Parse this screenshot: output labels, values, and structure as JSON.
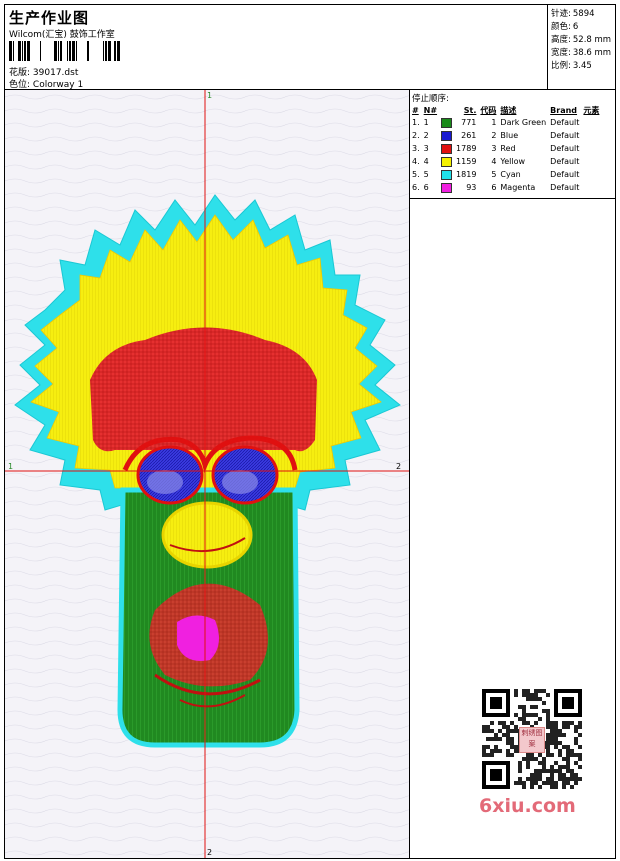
{
  "header": {
    "title": "生产作业图",
    "company": "Wilcom(汇宝) 鼓饰工作室",
    "design_label": "花版:",
    "design_value": "39017.dst",
    "colorway_label": "色位:",
    "colorway_value": "Colorway 1"
  },
  "stats": [
    {
      "label": "针迹:",
      "value": "5894"
    },
    {
      "label": "颜色:",
      "value": "6"
    },
    {
      "label": "高度:",
      "value": "52.8 mm"
    },
    {
      "label": "宽度:",
      "value": "38.6 mm"
    },
    {
      "label": "比例:",
      "value": "3.45"
    }
  ],
  "stop_sequence": {
    "title": "停止顺序:",
    "headers": [
      "#",
      "N#",
      "St.",
      "代码",
      "描述",
      "Brand",
      "元素"
    ],
    "rows": [
      {
        "num": "1.",
        "n": "1",
        "color": "#1a8a1a",
        "stitches": "771",
        "code": "1",
        "desc": "Dark Green",
        "brand": "Default"
      },
      {
        "num": "2.",
        "n": "2",
        "color": "#1a1ad0",
        "stitches": "261",
        "code": "2",
        "desc": "Blue",
        "brand": "Default"
      },
      {
        "num": "3.",
        "n": "3",
        "color": "#e01010",
        "stitches": "1789",
        "code": "3",
        "desc": "Red",
        "brand": "Default"
      },
      {
        "num": "4.",
        "n": "4",
        "color": "#f4f000",
        "stitches": "1159",
        "code": "4",
        "desc": "Yellow",
        "brand": "Default"
      },
      {
        "num": "5.",
        "n": "5",
        "color": "#20e0e8",
        "stitches": "1819",
        "code": "5",
        "desc": "Cyan",
        "brand": "Default"
      },
      {
        "num": "6.",
        "n": "6",
        "color": "#f020e0",
        "stitches": "93",
        "code": "6",
        "desc": "Magenta",
        "brand": "Default"
      }
    ]
  },
  "axes": {
    "top": "1",
    "left": "1",
    "right": "2",
    "bottom": "2"
  },
  "watermark": "6xiu.com",
  "qr_badge": "刺绣图案"
}
